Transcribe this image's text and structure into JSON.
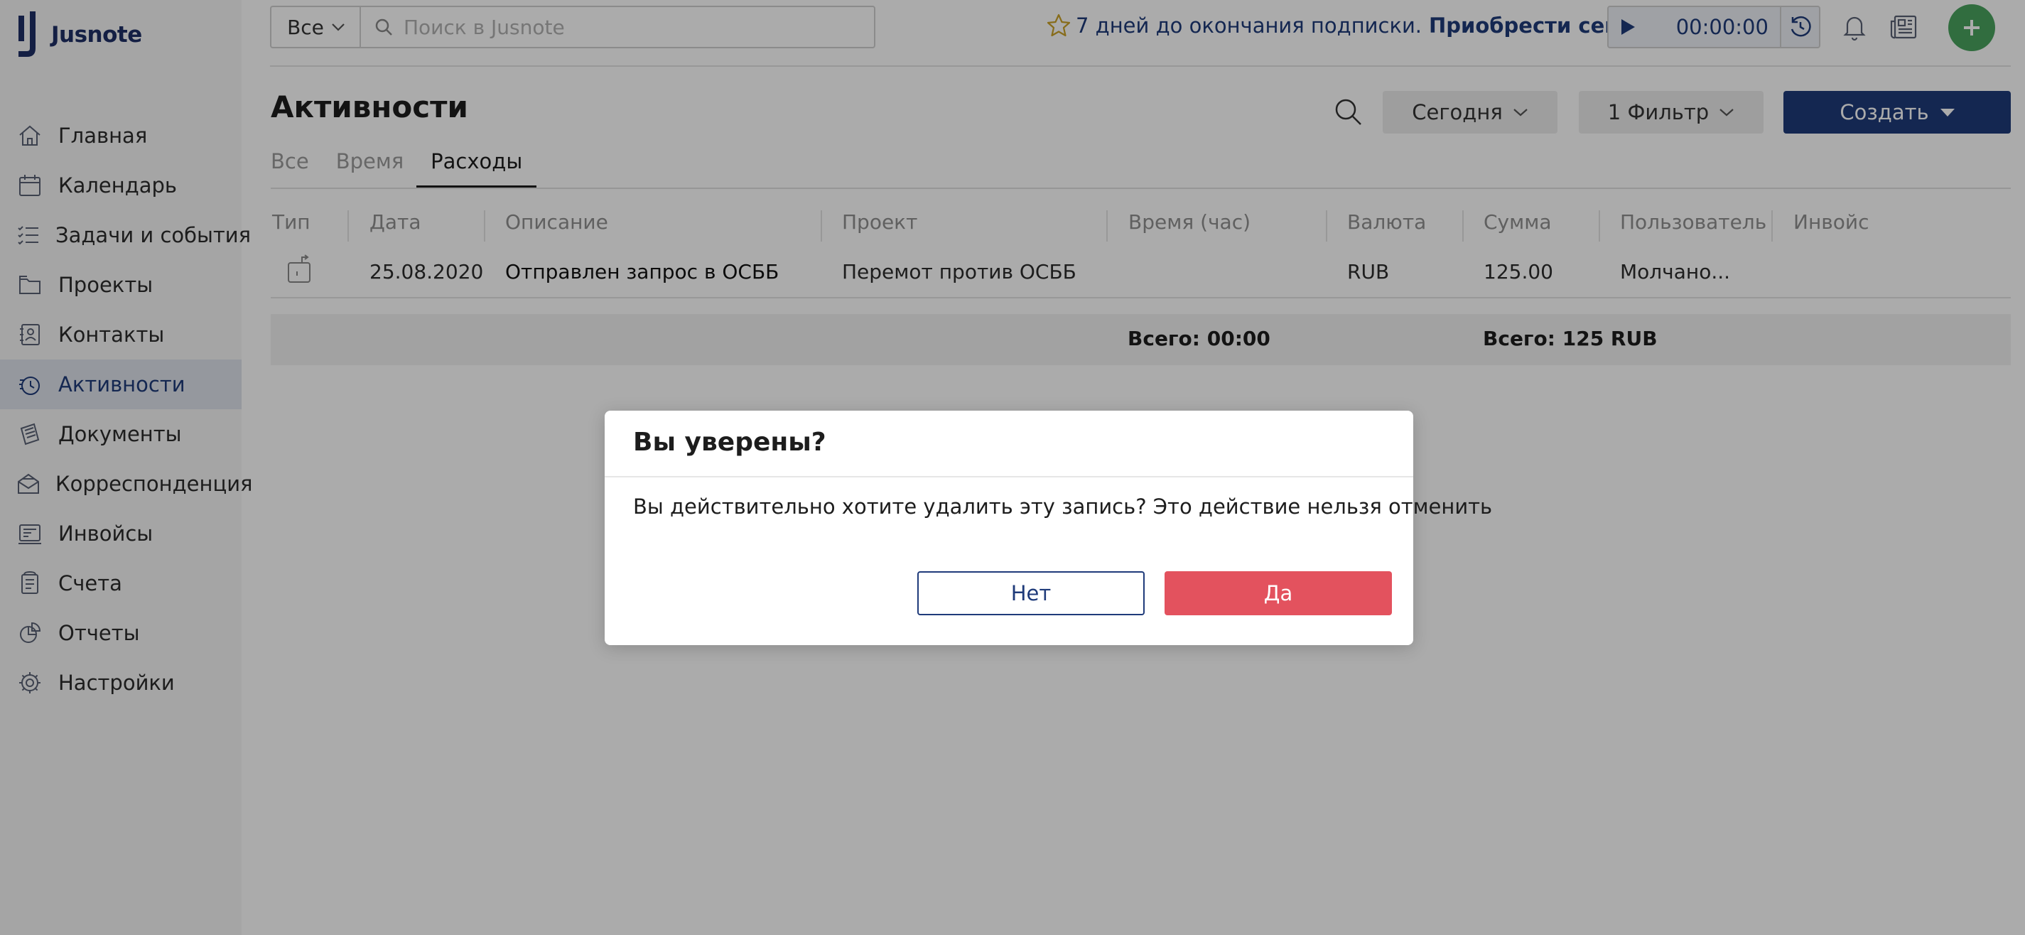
{
  "app": {
    "name": "Jusnote"
  },
  "sidebar": {
    "items": [
      {
        "label": "Главная",
        "icon": "home-icon",
        "active": false
      },
      {
        "label": "Календарь",
        "icon": "calendar-icon",
        "active": false
      },
      {
        "label": "Задачи и события",
        "icon": "tasks-icon",
        "active": false
      },
      {
        "label": "Проекты",
        "icon": "projects-icon",
        "active": false
      },
      {
        "label": "Контакты",
        "icon": "contacts-icon",
        "active": false
      },
      {
        "label": "Активности",
        "icon": "activity-icon",
        "active": true
      },
      {
        "label": "Документы",
        "icon": "documents-icon",
        "active": false
      },
      {
        "label": "Корреспонденция",
        "icon": "mail-icon",
        "active": false
      },
      {
        "label": "Инвойсы",
        "icon": "invoice-icon",
        "active": false
      },
      {
        "label": "Счета",
        "icon": "accounts-icon",
        "active": false
      },
      {
        "label": "Отчеты",
        "icon": "reports-icon",
        "active": false
      },
      {
        "label": "Настройки",
        "icon": "settings-icon",
        "active": false
      }
    ]
  },
  "topbar": {
    "scope": "Все",
    "search_placeholder": "Поиск в Jusnote",
    "subscription_text": "7 дней до окончания подписки.",
    "subscription_link": "Приобрести сейчас",
    "timer_value": "00:00:00"
  },
  "page": {
    "title": "Активности",
    "today_label": "Сегодня",
    "filter_label": "1 Фильтр",
    "create_label": "Создать",
    "tabs": [
      {
        "label": "Все",
        "active": false
      },
      {
        "label": "Время",
        "active": false
      },
      {
        "label": "Расходы",
        "active": true
      }
    ]
  },
  "table": {
    "columns": [
      "Тип",
      "Дата",
      "Описание",
      "Проект",
      "Время (час)",
      "Валюта",
      "Сумма",
      "Пользователь",
      "Инвойс"
    ],
    "rows": [
      {
        "type_icon": "expense-icon",
        "date": "25.08.2020",
        "description": "Отправлен запрос в ОСББ",
        "project": "Перемот против ОСББ",
        "hours": "",
        "currency": "RUB",
        "amount": "125.00",
        "user": "Молчано...",
        "invoice": ""
      }
    ],
    "totals": {
      "time": "Всего: 00:00",
      "amount": "Всего: 125 RUB"
    }
  },
  "modal": {
    "title": "Вы уверены?",
    "message": "Вы действительно хотите удалить эту запись? Это действие нельзя отменить",
    "no_label": "Нет",
    "yes_label": "Да"
  },
  "colors": {
    "brand": "#1f3b7a",
    "add_button": "#4aa35f",
    "danger": "#e3525e",
    "star": "#c9a227"
  }
}
